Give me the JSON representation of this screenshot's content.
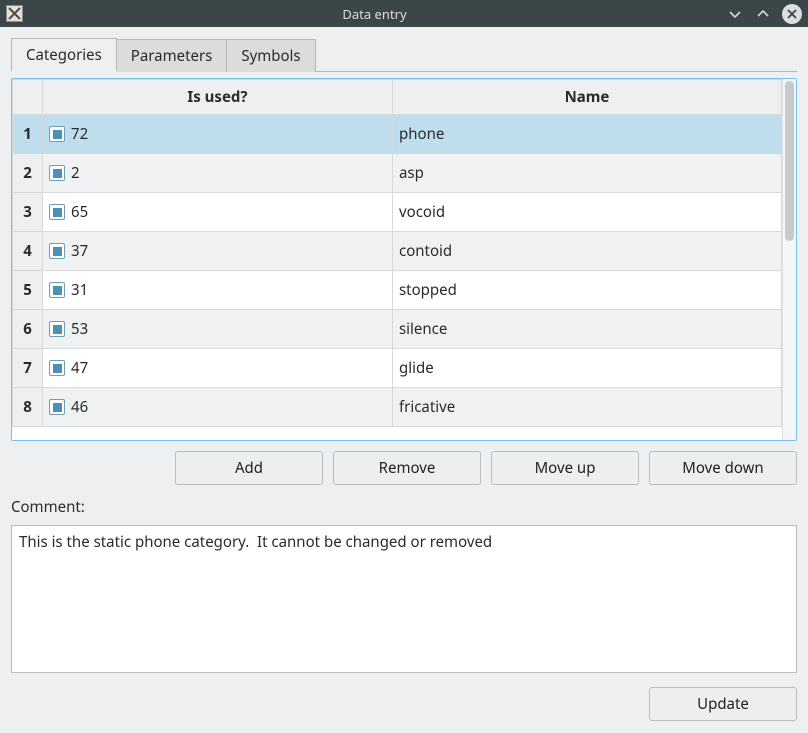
{
  "window": {
    "title": "Data entry"
  },
  "tabs": [
    {
      "label": "Categories",
      "active": true
    },
    {
      "label": "Parameters",
      "active": false
    },
    {
      "label": "Symbols",
      "active": false
    }
  ],
  "table": {
    "headers": {
      "isused": "Is used?",
      "name": "Name"
    },
    "rows": [
      {
        "num": "1",
        "used": true,
        "count": "72",
        "name": "phone",
        "selected": true
      },
      {
        "num": "2",
        "used": true,
        "count": "2",
        "name": "asp",
        "selected": false
      },
      {
        "num": "3",
        "used": true,
        "count": "65",
        "name": "vocoid",
        "selected": false
      },
      {
        "num": "4",
        "used": true,
        "count": "37",
        "name": "contoid",
        "selected": false
      },
      {
        "num": "5",
        "used": true,
        "count": "31",
        "name": "stopped",
        "selected": false
      },
      {
        "num": "6",
        "used": true,
        "count": "53",
        "name": "silence",
        "selected": false
      },
      {
        "num": "7",
        "used": true,
        "count": "47",
        "name": "glide",
        "selected": false
      },
      {
        "num": "8",
        "used": true,
        "count": "46",
        "name": "fricative",
        "selected": false
      }
    ]
  },
  "buttons": {
    "add": "Add",
    "remove": "Remove",
    "moveup": "Move up",
    "movedown": "Move down",
    "update": "Update"
  },
  "comment": {
    "label": "Comment:",
    "value": "This is the static phone category.  It cannot be changed or removed"
  }
}
